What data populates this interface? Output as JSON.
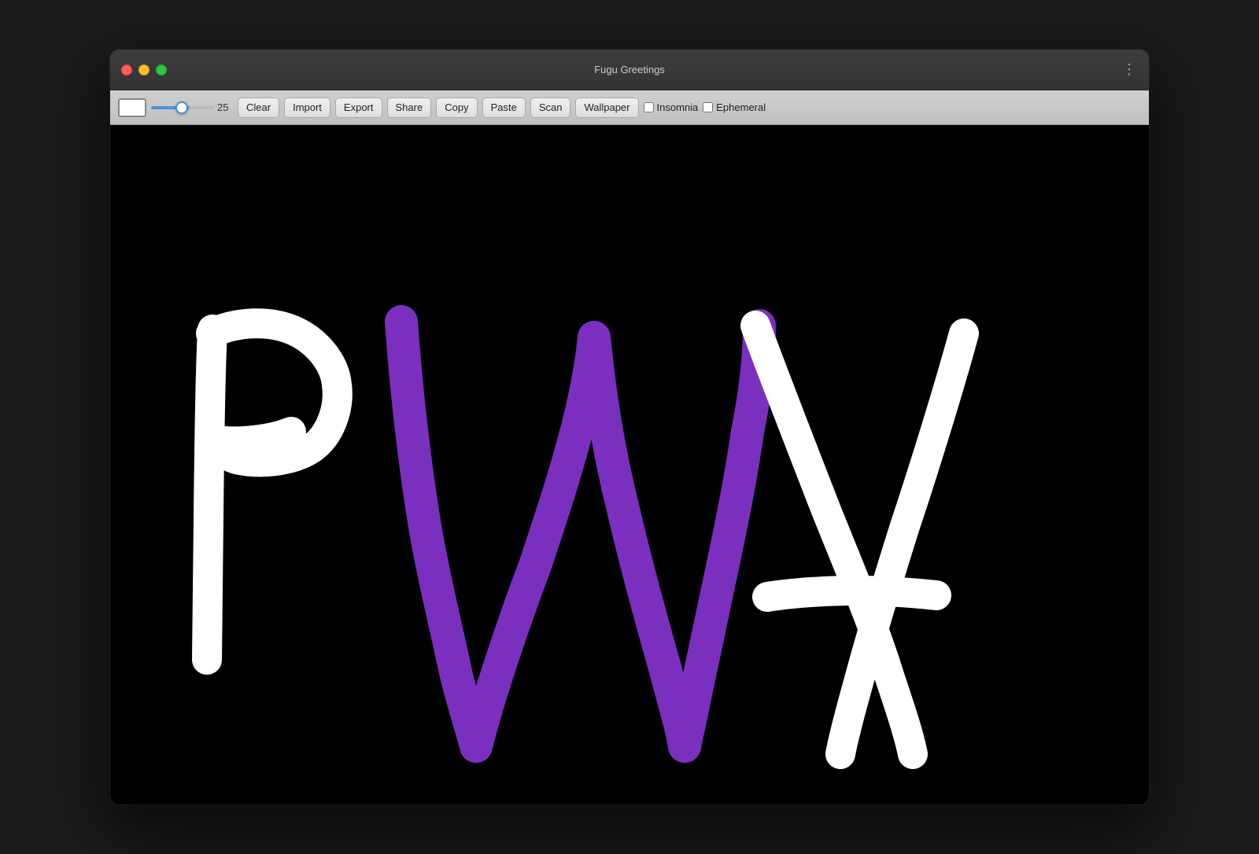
{
  "window": {
    "title": "Fugu Greetings",
    "traffic_lights": {
      "close_label": "close",
      "minimize_label": "minimize",
      "maximize_label": "maximize"
    },
    "menu_dots": "⋮"
  },
  "toolbar": {
    "brush_size": "25",
    "buttons": {
      "clear": "Clear",
      "import": "Import",
      "export": "Export",
      "share": "Share",
      "copy": "Copy",
      "paste": "Paste",
      "scan": "Scan",
      "wallpaper": "Wallpaper"
    },
    "checkboxes": {
      "insomnia_label": "Insomnia",
      "ephemeral_label": "Ephemeral"
    }
  }
}
